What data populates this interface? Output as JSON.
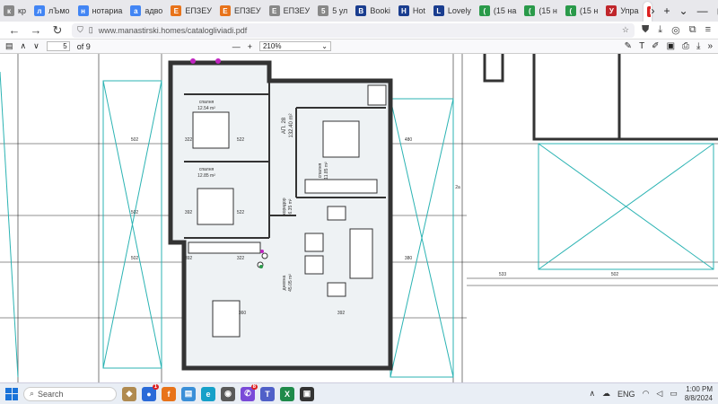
{
  "browser": {
    "tabs": [
      {
        "label": "кр",
        "icon": "doc-icon",
        "color": "#888888"
      },
      {
        "label": "лЪмо",
        "icon": "google-icon",
        "color": "#4285f4"
      },
      {
        "label": "нотариа",
        "icon": "google-icon",
        "color": "#4285f4"
      },
      {
        "label": "адво",
        "icon": "google-icon",
        "color": "#4285f4"
      },
      {
        "label": "ЕПЗЕУ",
        "icon": "building-icon",
        "color": "#e8731a"
      },
      {
        "label": "ЕПЗЕУ",
        "icon": "building-icon",
        "color": "#e8731a"
      },
      {
        "label": "ЕПЗЕУ",
        "icon": "doc-icon",
        "color": "#888888"
      },
      {
        "label": "5 ул",
        "icon": "doc-icon",
        "color": "#888888"
      },
      {
        "label": "Booki",
        "icon": "booking-icon",
        "color": "#1a3d8f"
      },
      {
        "label": "Hot",
        "icon": "booking-icon",
        "color": "#1a3d8f"
      },
      {
        "label": "Lovely",
        "icon": "booking-icon",
        "color": "#1a3d8f"
      },
      {
        "label": "(15 на",
        "icon": "house-icon",
        "color": "#2a9a4a"
      },
      {
        "label": "(15 н",
        "icon": "house-icon",
        "color": "#2a9a4a"
      },
      {
        "label": "(15 н",
        "icon": "house-icon",
        "color": "#2a9a4a"
      },
      {
        "label": "Упра",
        "icon": "circle-icon",
        "color": "#c0262b"
      }
    ],
    "active_tab": "catalo",
    "url": "www.manastirski.homes/catalogliviadi.pdf"
  },
  "pdf": {
    "page_current": "5",
    "page_total": "of 9",
    "zoom": "210%"
  },
  "plan": {
    "unit_label": "АП. 28",
    "unit_area": "132.40 m²",
    "rooms": [
      {
        "name": "спалня",
        "area": "12.54 m²"
      },
      {
        "name": "спалня",
        "area": "12.85 m²"
      },
      {
        "name": "спалня",
        "area": "11.85 m²"
      },
      {
        "name": "коридор",
        "area": "6.35 m²"
      },
      {
        "name": "дневна",
        "area": "45.05 m²"
      }
    ],
    "dims": [
      "502",
      "322",
      "522",
      "502",
      "392",
      "522",
      "502",
      "392",
      "322",
      "533",
      "502",
      "480",
      "380",
      "392",
      "360",
      "2a"
    ]
  },
  "taskbar": {
    "search_placeholder": "Search",
    "lang": "ENG",
    "time": "1:00 PM",
    "date": "8/8/2024",
    "badges": [
      "1",
      "8"
    ]
  },
  "colors": {
    "wall": "#333333",
    "dim_line": "#2bb3b3",
    "accent": "#1a73d9"
  }
}
